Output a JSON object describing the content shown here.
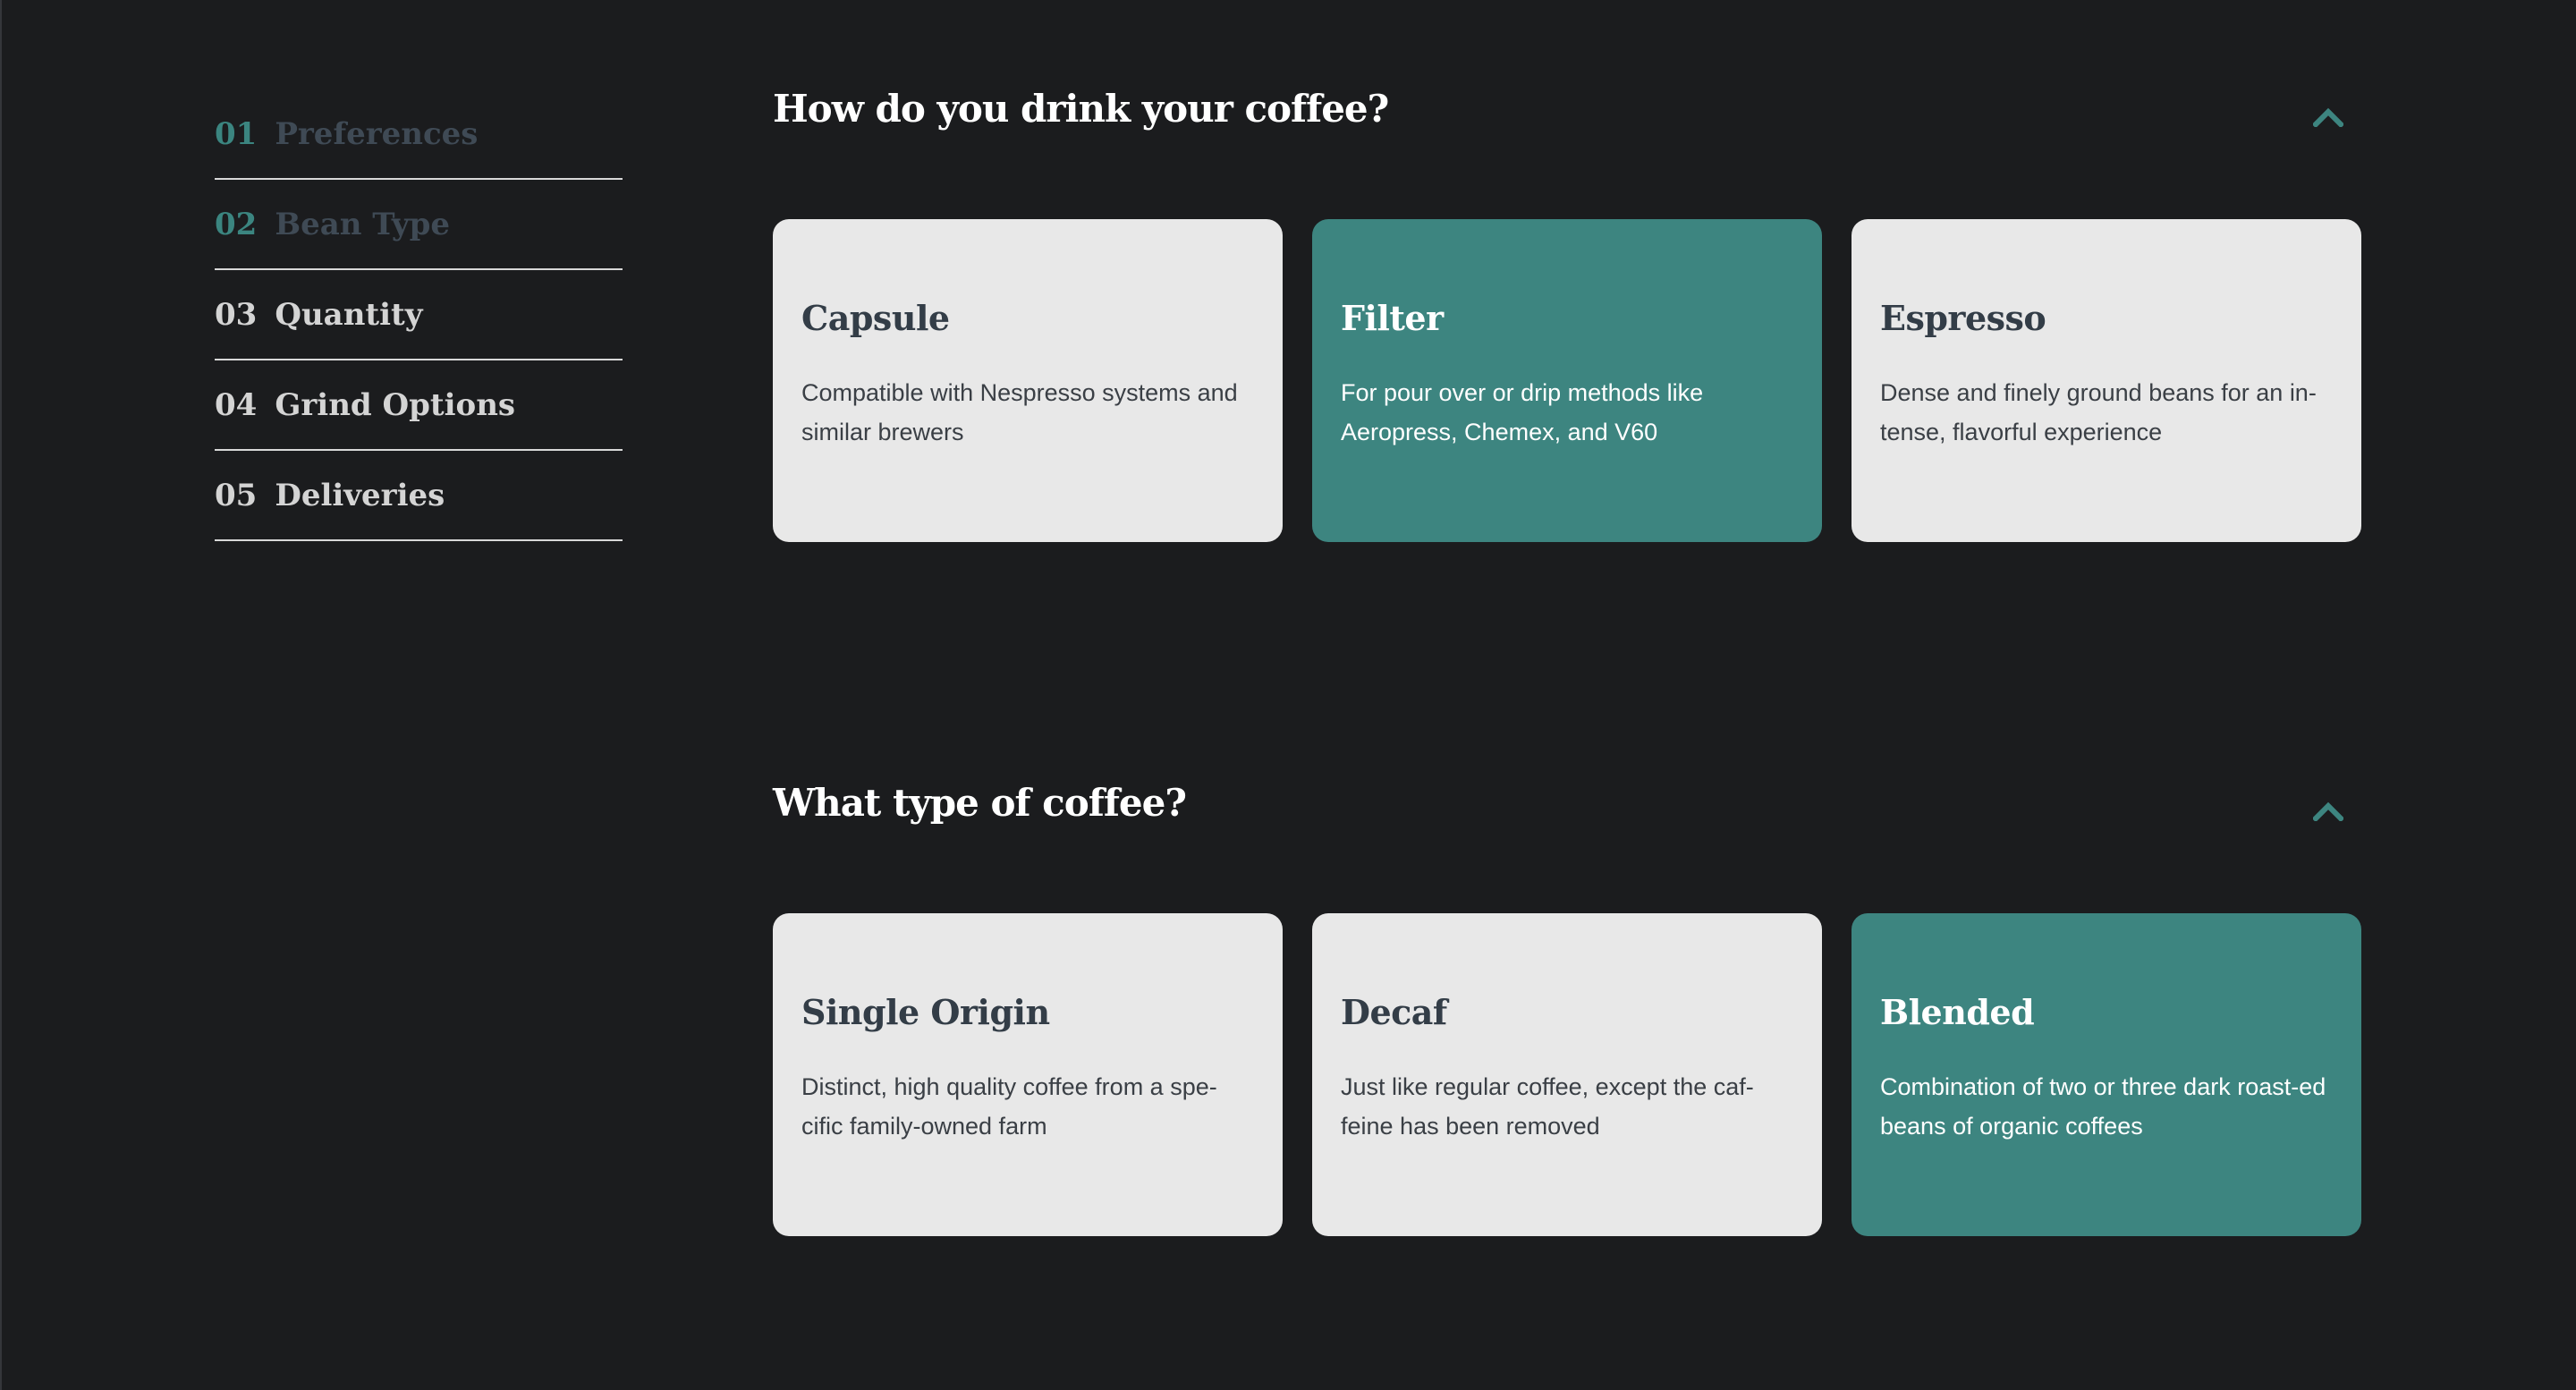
{
  "sidebar": {
    "steps": [
      {
        "num": "01",
        "label": "Preferences"
      },
      {
        "num": "02",
        "label": "Bean Type"
      },
      {
        "num": "03",
        "label": "Quantity"
      },
      {
        "num": "04",
        "label": "Grind Options"
      },
      {
        "num": "05",
        "label": "Deliveries"
      }
    ]
  },
  "sections": [
    {
      "title": "How do you drink your coffee?",
      "options": [
        {
          "title": "Capsule",
          "description": "Compatible with Nespresso systems and similar brewers",
          "selected": false
        },
        {
          "title": "Filter",
          "description": "For pour over or drip methods like Aeropress, Chemex, and V60",
          "selected": true
        },
        {
          "title": "Espresso",
          "description": "Dense and finely ground beans for an in-tense, flavorful experience",
          "selected": false
        }
      ]
    },
    {
      "title": "What type of coffee?",
      "options": [
        {
          "title": "Single Origin",
          "description": "Distinct, high quality coffee from a spe-cific family-owned farm",
          "selected": false
        },
        {
          "title": "Decaf",
          "description": "Just like regular coffee, except the caf-feine has been removed",
          "selected": false
        },
        {
          "title": "Blended",
          "description": "Combination of two or three dark roast-ed beans of organic coffees",
          "selected": true
        }
      ]
    }
  ],
  "colors": {
    "background": "#1b1c1e",
    "accent": "#3d8580",
    "card": "#e8e8e8",
    "dark_text": "#333d47"
  },
  "icons": {
    "collapse": "chevron-up-icon"
  }
}
